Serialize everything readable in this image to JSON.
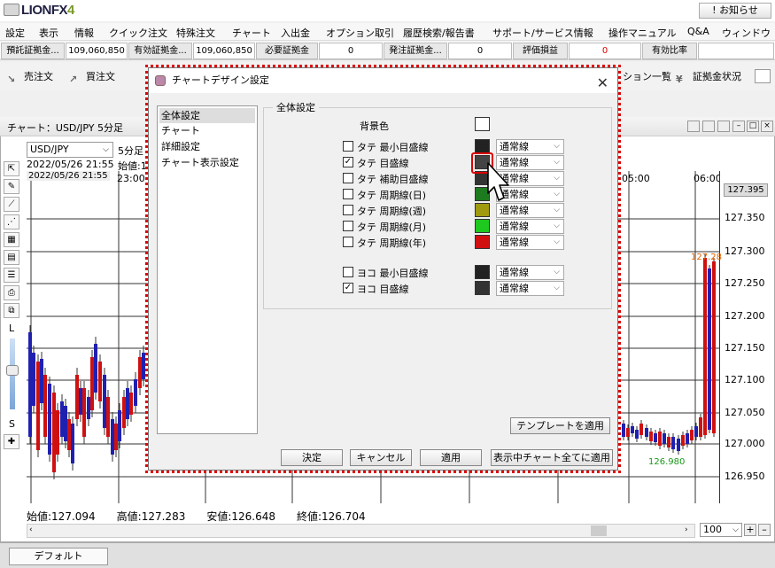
{
  "app": {
    "logo_text": "LIONFX",
    "logo_number": "4",
    "notice_button": "! お知らせ"
  },
  "menu": [
    "設定",
    "表示",
    "情報",
    "クイック注文",
    "特殊注文",
    "チャート",
    "入出金",
    "オプション取引",
    "履歴検索/報告書",
    "サポート/サービス情報",
    "操作マニュアル",
    "Q&A",
    "ウィンドウ"
  ],
  "account": [
    {
      "label": "預託証拠金...",
      "value": "109,060,850"
    },
    {
      "label": "有効証拠金...",
      "value": "109,060,850"
    },
    {
      "label": "必要証拠金",
      "value": "0"
    },
    {
      "label": "発注証拠金...",
      "value": "0"
    },
    {
      "label": "評価損益",
      "value": "0"
    },
    {
      "label": "有効比率",
      "value": ""
    }
  ],
  "toolbar": {
    "sell": "売注文",
    "buy": "買注文",
    "position_list": "ション一覧",
    "margin_status": "証拠金状況"
  },
  "chart": {
    "title": "チャート：USD/JPY 5分足",
    "symbol": "USD/JPY",
    "timeframe": "5分足",
    "datetime": "2022/05/26 21:55",
    "open_label": "始値:1",
    "cursor_date": "2022/05/26 21:55",
    "time_labels": [
      "23:00",
      "05:00",
      "06:00"
    ],
    "price_ticks": [
      "127.350",
      "127.300",
      "127.250",
      "127.200",
      "127.150",
      "127.100",
      "127.050",
      "127.000",
      "126.950"
    ],
    "current_price": "127.395",
    "high_marker": "127.28",
    "low_marker": "126.980",
    "ohlc": "始値:127.094　　高値:127.283　　安値:126.648　　終値:126.704",
    "zoom": "100",
    "side_L": "L",
    "side_S": "S"
  },
  "bottom_tab": "デフォルト",
  "dialog": {
    "title": "チャートデザイン設定",
    "nav": [
      "全体設定",
      "チャート",
      "詳細設定",
      "チャート表示設定"
    ],
    "group_title": "全体設定",
    "background_label": "背景色",
    "rows": [
      {
        "label": "タテ 最小目盛線",
        "checked": false,
        "color": "#222222",
        "line": "通常線"
      },
      {
        "label": "タテ 目盛線",
        "checked": true,
        "color": "#444444",
        "line": "通常線"
      },
      {
        "label": "タテ 補助目盛線",
        "checked": false,
        "color": "#333333",
        "line": "通常線"
      },
      {
        "label": "タテ 周期線(日)",
        "checked": false,
        "color": "#1e7a1e",
        "line": "通常線"
      },
      {
        "label": "タテ 周期線(週)",
        "checked": false,
        "color": "#a09a10",
        "line": "通常線"
      },
      {
        "label": "タテ 周期線(月)",
        "checked": false,
        "color": "#1ec81e",
        "line": "通常線"
      },
      {
        "label": "タテ 周期線(年)",
        "checked": false,
        "color": "#d01010",
        "line": "通常線"
      },
      {
        "label": "ヨコ 最小目盛線",
        "checked": false,
        "color": "#222222",
        "line": "通常線"
      },
      {
        "label": "ヨコ 目盛線",
        "checked": true,
        "color": "#333333",
        "line": "通常線"
      }
    ],
    "template_button": "テンプレートを適用",
    "ok": "決定",
    "cancel": "キャンセル",
    "apply": "適用",
    "apply_all": "表示中チャート全てに適用",
    "checkmark": "✓",
    "dropdown_arrow": "⌵"
  }
}
